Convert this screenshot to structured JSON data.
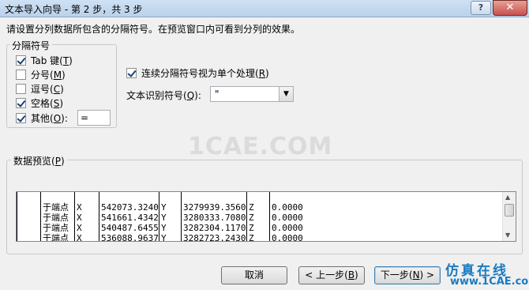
{
  "window": {
    "title": "文本导入向导 - 第 2 步，共 3 步",
    "help_label": "?",
    "close_label": "✕"
  },
  "instruction": "请设置分列数据所包含的分隔符号。在预览窗口内可看到分列的效果。",
  "delimiters": {
    "group_label": "分隔符号",
    "items": [
      {
        "label": "Tab 键(",
        "key": "T",
        "suffix": ")",
        "checked": true
      },
      {
        "label": "分号(",
        "key": "M",
        "suffix": ")",
        "checked": false
      },
      {
        "label": "逗号(",
        "key": "C",
        "suffix": ")",
        "checked": false
      },
      {
        "label": "空格(",
        "key": "S",
        "suffix": ")",
        "checked": true
      },
      {
        "label": "其他(",
        "key": "O",
        "suffix": "):",
        "checked": true
      }
    ],
    "other_value": "="
  },
  "consecutive": {
    "label": "连续分隔符号视为单个处理(",
    "key": "R",
    "suffix": ")",
    "checked": true
  },
  "qualifier": {
    "label": "文本识别符号(",
    "key": "Q",
    "suffix": "):",
    "value": "\""
  },
  "watermark": "1CAE.COM",
  "preview": {
    "label": "数据预览(",
    "key": "P",
    "suffix": ")",
    "rows": [
      [
        "",
        "",
        "",
        "",
        "",
        "",
        "",
        ""
      ],
      [
        "",
        "于端点",
        "X",
        "542073.3240",
        "Y",
        "3279939.3560",
        "Z",
        "0.0000"
      ],
      [
        "",
        "于端点",
        "X",
        "541661.4342",
        "Y",
        "3280333.7080",
        "Z",
        "0.0000"
      ],
      [
        "",
        "于端点",
        "X",
        "540487.6455",
        "Y",
        "3282304.1170",
        "Z",
        "0.0000"
      ],
      [
        "",
        "于端点",
        "X",
        "536088.9637",
        "Y",
        "3282723.2430",
        "Z",
        "0.0000"
      ]
    ]
  },
  "buttons": {
    "cancel": "取消",
    "back": "< 上一步(",
    "back_key": "B",
    "back_suffix": ")",
    "next": "下一步(",
    "next_key": "N",
    "next_suffix": ") >"
  },
  "brand": {
    "top": "仿真在线",
    "bottom": "www.1CAE.com"
  }
}
